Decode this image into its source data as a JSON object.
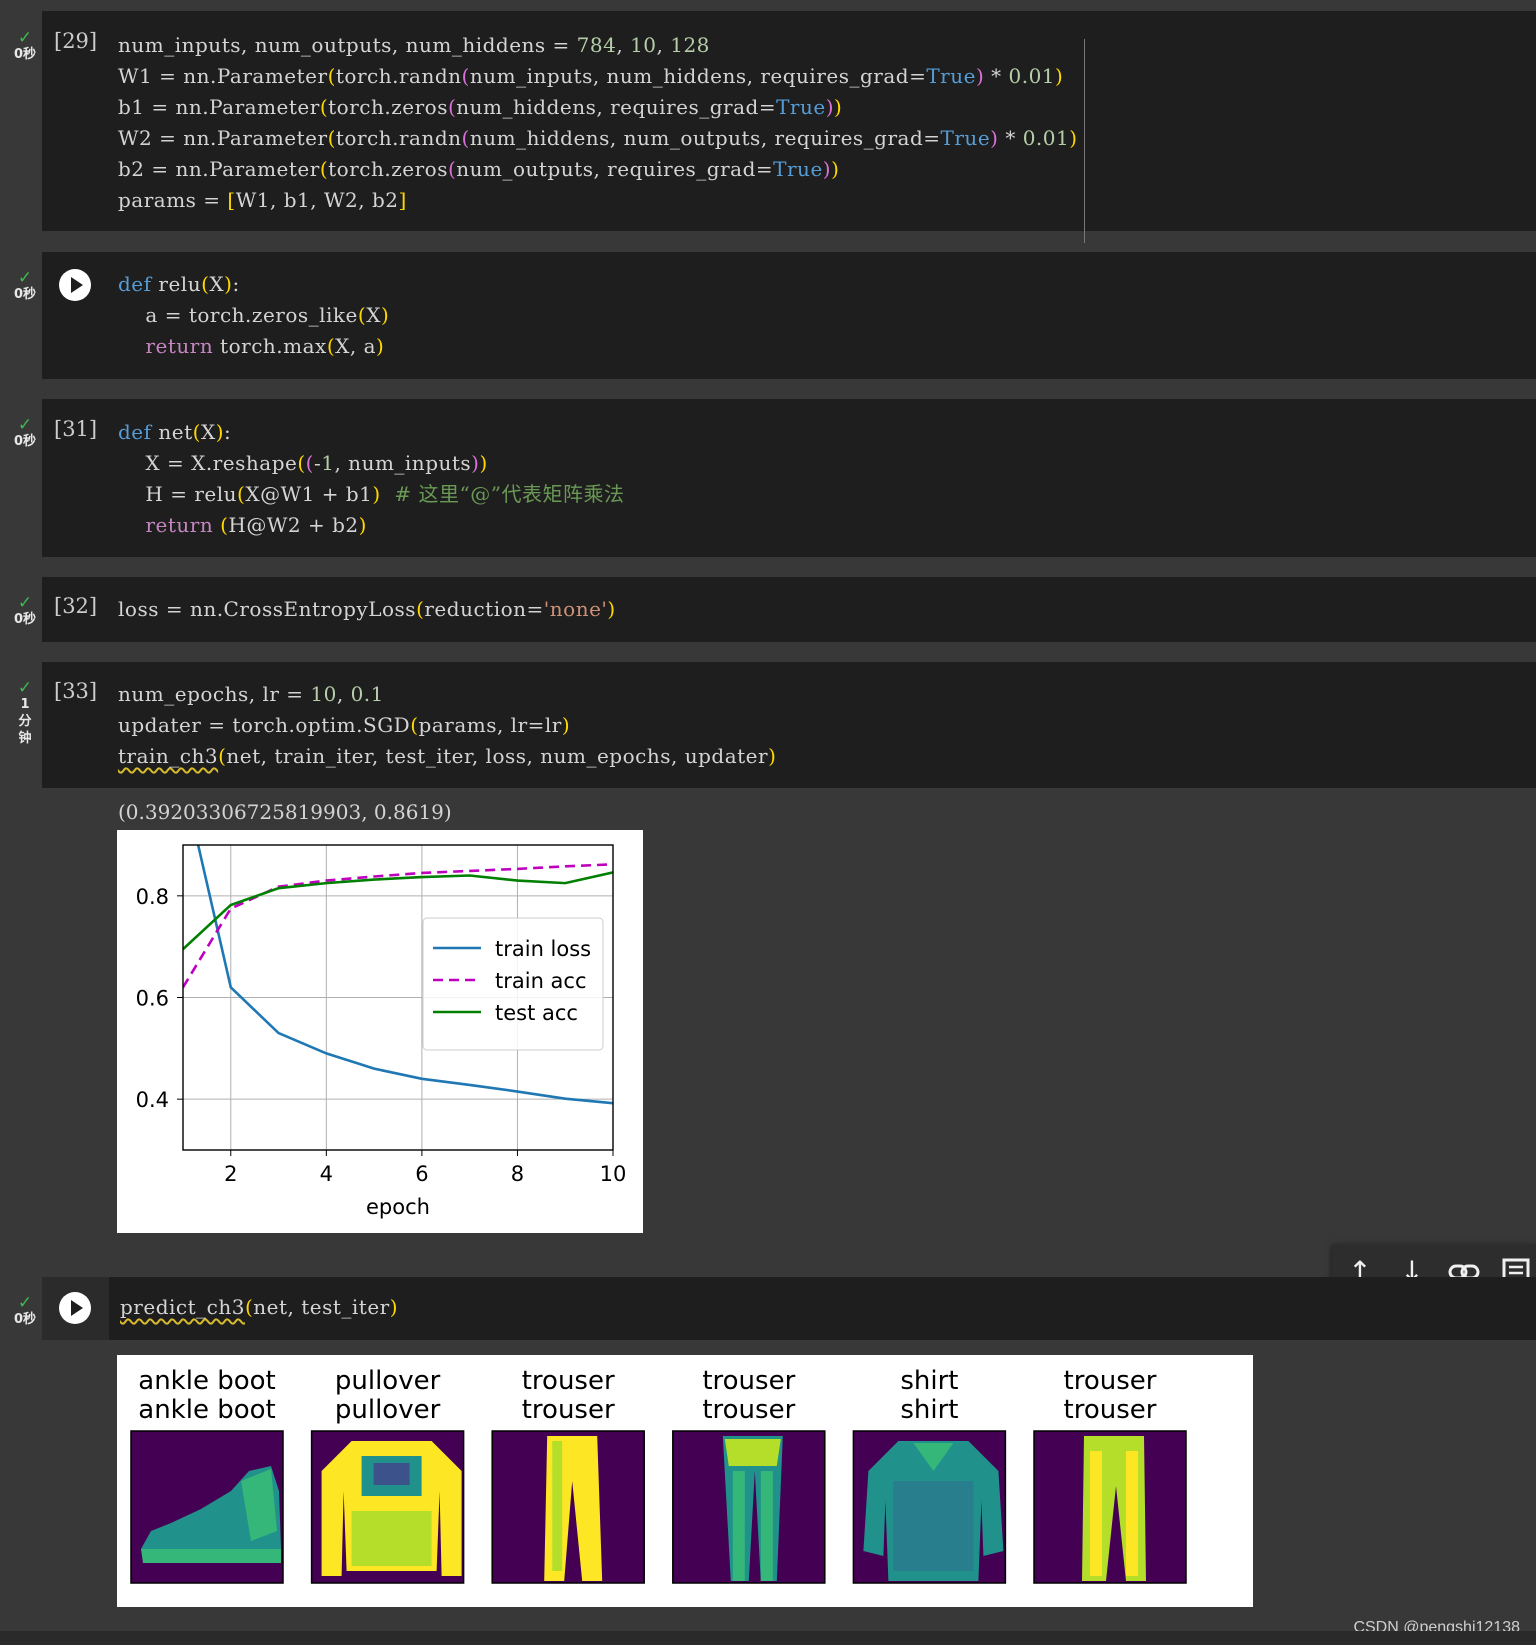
{
  "cells": [
    {
      "status_time": "0秒",
      "exec_count": "[29]"
    },
    {
      "status_time": "0秒",
      "exec_count": ""
    },
    {
      "status_time": "0秒",
      "exec_count": "[31]"
    },
    {
      "status_time": "0秒",
      "exec_count": "[32]"
    },
    {
      "status_time": "1分钟",
      "exec_count": "[33]"
    },
    {
      "status_time": "0秒",
      "exec_count": ""
    }
  ],
  "code": {
    "cell29": [
      "num_inputs, num_outputs, num_hiddens = 784, 10, 128",
      "W1 = nn.Parameter(torch.randn(num_inputs, num_hiddens, requires_grad=True) * 0.01)",
      "b1 = nn.Parameter(torch.zeros(num_hiddens, requires_grad=True))",
      "W2 = nn.Parameter(torch.randn(num_hiddens, num_outputs, requires_grad=True) * 0.01)",
      "b2 = nn.Parameter(torch.zeros(num_outputs, requires_grad=True))",
      "params = [W1, b1, W2, b2]"
    ],
    "cell30": [
      "def relu(X):",
      "    a = torch.zeros_like(X)",
      "    return torch.max(X, a)"
    ],
    "cell31": [
      "def net(X):",
      "    X = X.reshape((-1, num_inputs))",
      "    H = relu(X@W1 + b1)  # 这里“@”代表矩阵乘法",
      "    return (H@W2 + b2)"
    ],
    "cell32": [
      "loss = nn.CrossEntropyLoss(reduction='none')"
    ],
    "cell33": [
      "num_epochs, lr = 10, 0.1",
      "updater = torch.optim.SGD(params, lr=lr)",
      "train_ch3(net, train_iter, test_iter, loss, num_epochs, updater)"
    ],
    "cell34": [
      "predict_ch3(net, test_iter)"
    ]
  },
  "output_text": "(0.39203306725819903, 0.8619)",
  "chart_data": {
    "type": "line",
    "xlabel": "epoch",
    "ylabel": "",
    "xlim": [
      1,
      10
    ],
    "ylim": [
      0.3,
      0.9
    ],
    "xticks": [
      "2",
      "4",
      "6",
      "8",
      "10"
    ],
    "yticks": [
      "0.4",
      "0.6",
      "0.8"
    ],
    "grid": true,
    "legend_position": "center-right",
    "x": [
      1,
      2,
      3,
      4,
      5,
      6,
      7,
      8,
      9,
      10
    ],
    "series": [
      {
        "name": "train loss",
        "color": "#1f77b4",
        "style": "solid",
        "values": [
          1.03,
          0.62,
          0.53,
          0.49,
          0.46,
          0.44,
          0.428,
          0.415,
          0.401,
          0.392
        ]
      },
      {
        "name": "train acc",
        "color": "#bf00bf",
        "style": "dashed",
        "values": [
          0.62,
          0.775,
          0.818,
          0.83,
          0.838,
          0.845,
          0.849,
          0.853,
          0.858,
          0.862
        ]
      },
      {
        "name": "test acc",
        "color": "#008000",
        "style": "solid",
        "values": [
          0.695,
          0.782,
          0.815,
          0.825,
          0.832,
          0.837,
          0.84,
          0.83,
          0.825,
          0.846
        ]
      }
    ]
  },
  "predictions": [
    {
      "label_true": "ankle boot",
      "label_pred": "ankle boot",
      "kind": "boot"
    },
    {
      "label_true": "pullover",
      "label_pred": "pullover",
      "kind": "pullover"
    },
    {
      "label_true": "trouser",
      "label_pred": "trouser",
      "kind": "trouser"
    },
    {
      "label_true": "trouser",
      "label_pred": "trouser",
      "kind": "trouser2"
    },
    {
      "label_true": "shirt",
      "label_pred": "shirt",
      "kind": "shirt"
    },
    {
      "label_true": "trouser",
      "label_pred": "trouser",
      "kind": "trouser3"
    }
  ],
  "watermark": "CSDN @pengshi12138",
  "colors": {
    "bg": "#383838",
    "cell_bg": "#1e1e1e",
    "check": "#3fb950",
    "image_bg": "#440154"
  }
}
